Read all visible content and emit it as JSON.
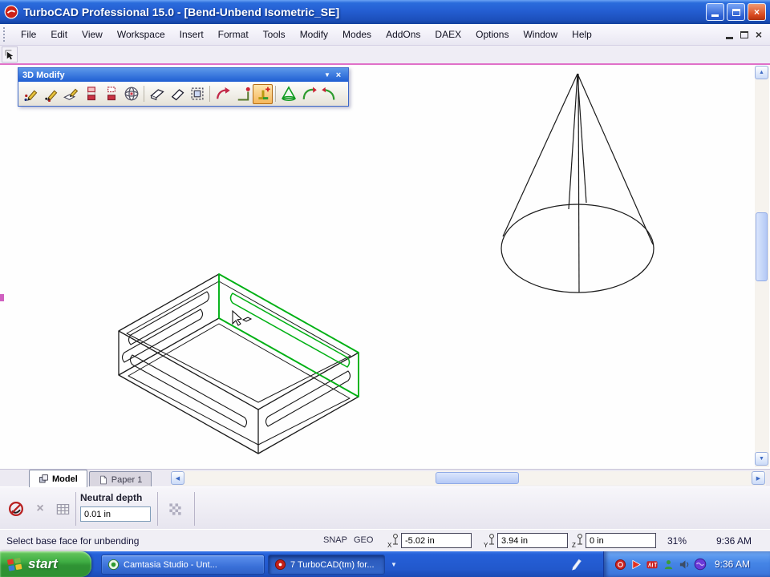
{
  "window": {
    "title": "TurboCAD Professional 15.0 - [Bend-Unbend Isometric_SE]",
    "control_icons": [
      "minimize-icon",
      "restore-icon",
      "close-icon"
    ]
  },
  "menu": {
    "items": [
      "File",
      "Edit",
      "View",
      "Workspace",
      "Insert",
      "Format",
      "Tools",
      "Modify",
      "Modes",
      "AddOns",
      "DAEX",
      "Options",
      "Window",
      "Help"
    ],
    "mdi_control_icons": [
      "minimize-icon",
      "restore-icon",
      "close-icon"
    ]
  },
  "modify_toolbar": {
    "title": "3D Modify",
    "buttons": [
      "assemble-by-point",
      "assemble-by-axis",
      "assemble-by-face",
      "boolean-add",
      "boolean-subtract",
      "boolean-intersect",
      "facet-offset",
      "facet-delete",
      "select-face",
      "bend",
      "bend-by-angle",
      "unbend",
      "cone",
      "bend-arc",
      "unbend-arc"
    ],
    "active_button": "unbend"
  },
  "canvas": {
    "objects": [
      "cone-wireframe",
      "slotted-box-wireframe"
    ],
    "selected_face_color": "#00b014"
  },
  "tabs": {
    "items": [
      {
        "label": "Model",
        "active": true
      },
      {
        "label": "Paper 1",
        "active": false
      }
    ]
  },
  "inspector": {
    "neutral_depth_label": "Neutral depth",
    "neutral_depth_value": "0.01 in",
    "icons": [
      "no-selection-icon",
      "cancel-icon",
      "table-icon",
      "hatch-icon"
    ]
  },
  "status": {
    "message": "Select base face for unbending",
    "snap_label": "SNAP",
    "geo_label": "GEO",
    "coords": [
      {
        "axis": "X",
        "value": "-5.02 in"
      },
      {
        "axis": "Y",
        "value": "3.94 in"
      },
      {
        "axis": "Z",
        "value": "0 in"
      }
    ],
    "zoom_level": "31%",
    "time": "9:36 AM"
  },
  "taskbar": {
    "start_label": "start",
    "tasks": [
      {
        "label": "Camtasia Studio - Unt...",
        "icon": "camtasia-icon",
        "active": false
      },
      {
        "label": "7 TurboCAD(tm) for...",
        "icon": "turbocad-icon",
        "active": true
      }
    ],
    "tray_icons": [
      "recorder-icon",
      "messenger-arrow-icon",
      "ati-icon",
      "user-icon",
      "volume-icon",
      "purple-app-icon"
    ],
    "clock": "9:36 AM"
  },
  "colors": {
    "selection_green": "#00b014",
    "titlebar_blue": "#245ed2",
    "taskbar_blue": "#2258cc",
    "start_green": "#3fae43",
    "active_tool_orange": "#f6b75c",
    "guide_magenta": "#e070c8"
  }
}
